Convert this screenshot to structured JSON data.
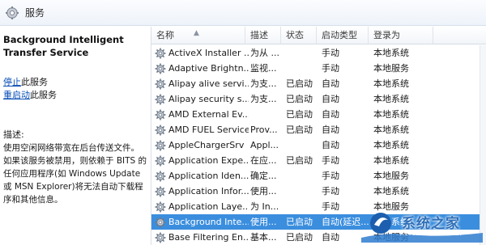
{
  "window": {
    "title": "服务"
  },
  "details": {
    "service_name": "Background Intelligent Transfer Service",
    "actions": [
      {
        "link": "停止",
        "suffix": "此服务"
      },
      {
        "link": "重启动",
        "suffix": "此服务"
      }
    ],
    "description_label": "描述:",
    "description_text": "使用空闲网络带宽在后台传送文件。如果该服务被禁用，则依赖于 BITS 的任何应用程序(如 Windows Update 或 MSN Explorer)将无法自动下载程序和其他信息。"
  },
  "columns": {
    "name": "名称",
    "description": "描述",
    "status": "状态",
    "startup_type": "启动类型",
    "logon_as": "登录为"
  },
  "services": [
    {
      "name": "ActiveX Installer ...",
      "description": "为从 ...",
      "status": "",
      "startup": "手动",
      "logon": "本地系统"
    },
    {
      "name": "Adaptive Brightn...",
      "description": "监视...",
      "status": "",
      "startup": "手动",
      "logon": "本地服务"
    },
    {
      "name": "Alipay alive servi...",
      "description": "为支...",
      "status": "已启动",
      "startup": "自动",
      "logon": "本地系统"
    },
    {
      "name": "Alipay security s...",
      "description": "为支...",
      "status": "已启动",
      "startup": "自动",
      "logon": "本地系统"
    },
    {
      "name": "AMD External Ev...",
      "description": "",
      "status": "已启动",
      "startup": "自动",
      "logon": "本地系统"
    },
    {
      "name": "AMD FUEL Service",
      "description": "Prov...",
      "status": "已启动",
      "startup": "自动",
      "logon": "本地系统"
    },
    {
      "name": "AppleChargerSrv",
      "description": "Appl...",
      "status": "",
      "startup": "自动",
      "logon": "本地系统"
    },
    {
      "name": "Application Expe...",
      "description": "在应...",
      "status": "已启动",
      "startup": "手动",
      "logon": "本地系统"
    },
    {
      "name": "Application Iden...",
      "description": "确定...",
      "status": "",
      "startup": "手动",
      "logon": "本地服务"
    },
    {
      "name": "Application Infor...",
      "description": "使用...",
      "status": "",
      "startup": "手动",
      "logon": "本地系统"
    },
    {
      "name": "Application Laye...",
      "description": "为 In...",
      "status": "",
      "startup": "手动",
      "logon": "本地服务"
    },
    {
      "name": "Background Inte...",
      "description": "使用...",
      "status": "已启动",
      "startup": "自动(延迟...",
      "logon": "本地系统",
      "selected": true
    },
    {
      "name": "Base Filtering En...",
      "description": "基本...",
      "status": "已启动",
      "startup": "自动",
      "logon": "本地服务"
    }
  ],
  "watermark": {
    "brand": "系统之家",
    "url": "XITONGZHIJIA.NET"
  }
}
